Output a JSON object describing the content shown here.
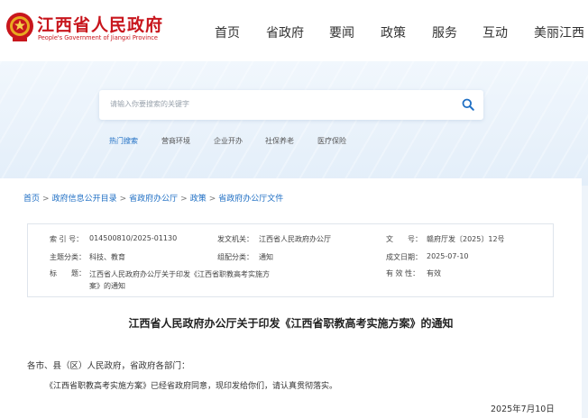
{
  "header": {
    "brand_cn": "江西省人民政府",
    "brand_en": "People's Government of Jiangxi Province",
    "nav": [
      "首页",
      "省政府",
      "要闻",
      "政策",
      "服务",
      "互动",
      "美丽江西"
    ]
  },
  "search": {
    "placeholder": "请输入你要搜索的关键字",
    "hot": [
      "热门搜索",
      "营商环境",
      "企业开办",
      "社保养老",
      "医疗保险"
    ]
  },
  "breadcrumb": [
    "首页",
    "政府信息公开目录",
    "省政府办公厅",
    "政策",
    "省政府办公厅文件"
  ],
  "meta": {
    "index_label": "索 引 号：",
    "index_value": "014500810/2025-01130",
    "issuer_label": "发文机关：",
    "issuer_value": "江西省人民政府办公厅",
    "docno_label": "文　　号：",
    "docno_value": "赣府厅发〔2025〕12号",
    "topic_label": "主题分类：",
    "topic_value": "科技、教育",
    "form_label": "组配分类：",
    "form_value": "通知",
    "date_label": "成文日期：",
    "date_value": "2025-07-10",
    "title_label": "标　　题：",
    "title_value": "江西省人民政府办公厅关于印发《江西省职教高考实施方案》的通知",
    "validity_label": "有 效 性：",
    "validity_value": "有效"
  },
  "document": {
    "title": "江西省人民政府办公厅关于印发《江西省职教高考实施方案》的通知",
    "salutation": "各市、县（区）人民政府，省政府各部门：",
    "body": "《江西省职教高考实施方案》已经省政府同意，现印发给你们，请认真贯彻落实。",
    "date": "2025年7月10日"
  },
  "colors": {
    "brand_red": "#c8161d",
    "link_blue": "#1f6fc4"
  }
}
